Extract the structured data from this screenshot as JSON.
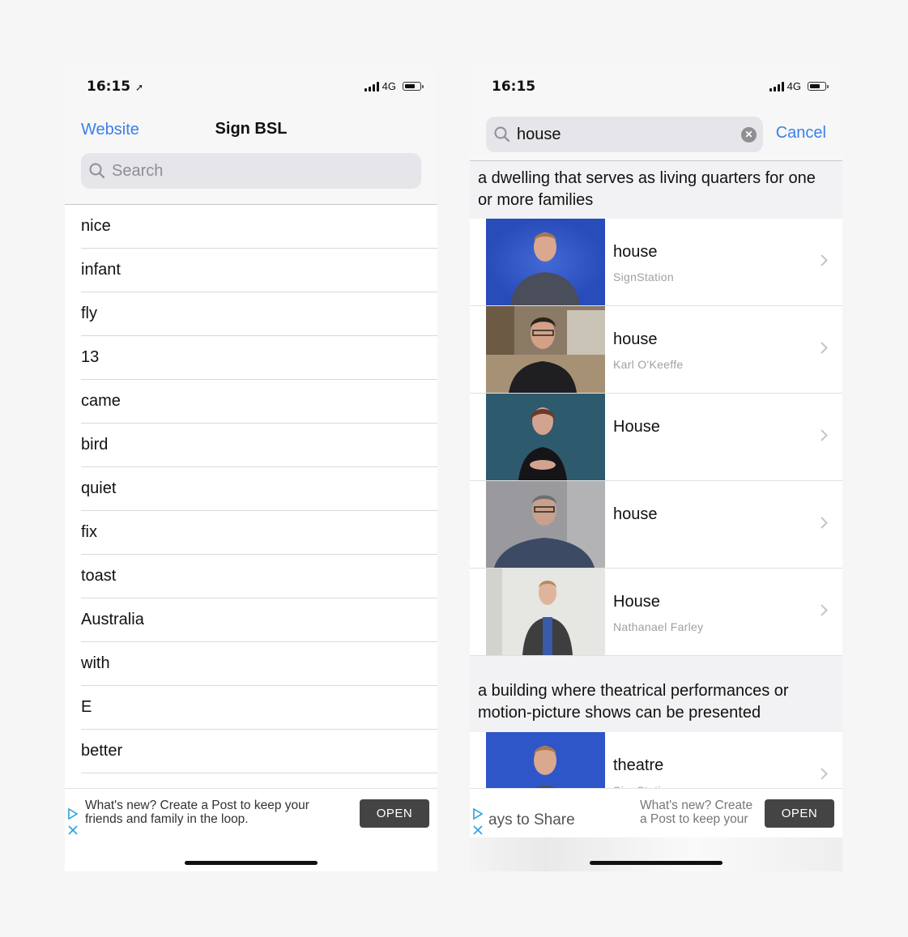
{
  "left": {
    "status": {
      "time": "16:15",
      "network": "4G"
    },
    "nav": {
      "website_label": "Website",
      "title": "Sign BSL"
    },
    "search": {
      "placeholder": "Search"
    },
    "items": [
      "nice",
      "infant",
      "fly",
      "13",
      "came",
      "bird",
      "quiet",
      "fix",
      "toast",
      "Australia",
      "with",
      "E",
      "better"
    ],
    "ad": {
      "text": "What's new? Create a Post to keep your friends and family in the loop.",
      "button": "OPEN"
    }
  },
  "right": {
    "status": {
      "time": "16:15",
      "network": "4G"
    },
    "search": {
      "query": "house",
      "cancel_label": "Cancel"
    },
    "sections": [
      {
        "header": "a dwelling that serves as living quarters for one or more families",
        "rows": [
          {
            "title": "house",
            "subtitle": "SignStation"
          },
          {
            "title": "house",
            "subtitle": "Karl O'Keeffe"
          },
          {
            "title": "House",
            "subtitle": ""
          },
          {
            "title": "house",
            "subtitle": ""
          },
          {
            "title": "House",
            "subtitle": "Nathanael Farley"
          }
        ]
      },
      {
        "header": "a building where theatrical performances or motion-picture shows can be presented",
        "rows": [
          {
            "title": "theatre",
            "subtitle": "SignStation"
          }
        ]
      }
    ],
    "ad": {
      "scroll_text": "ays to Share",
      "text": "What's new? Create a Post to keep your friends and family in the loop.",
      "button": "OPEN"
    }
  },
  "colors": {
    "accent": "#3a80e8",
    "ad_button": "#444444"
  }
}
